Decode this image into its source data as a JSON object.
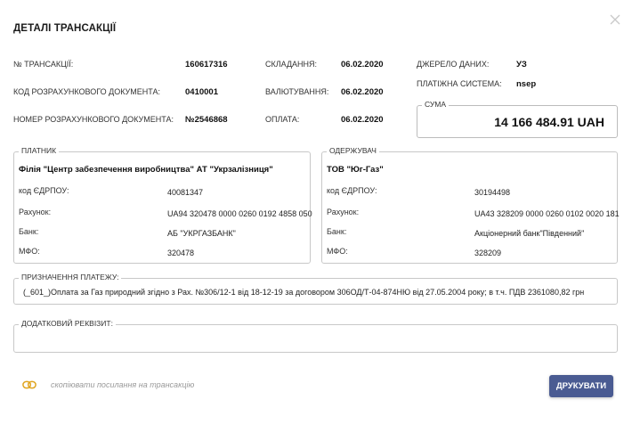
{
  "title": "ДЕТАЛІ ТРАНСАКЦІЇ",
  "transaction": {
    "number_label": "№ ТРАНСАКЦІЇ:",
    "number_value": "160617316",
    "doc_code_label": "КОД РОЗРАХУНКОВОГО ДОКУМЕНТА:",
    "doc_code_value": "0410001",
    "doc_number_label": "НОМЕР РОЗРАХУНКОВОГО ДОКУМЕНТА:",
    "doc_number_value": "№2546868",
    "compiled_label": "СКЛАДАННЯ:",
    "compiled_value": "06.02.2020",
    "valued_label": "ВАЛЮТУВАННЯ:",
    "valued_value": "06.02.2020",
    "paid_label": "ОПЛАТА:",
    "paid_value": "06.02.2020",
    "source_label": "ДЖЕРЕЛО ДАНИХ:",
    "source_value": "УЗ",
    "system_label": "ПЛАТІЖНА СИСТЕМА:",
    "system_value": "nsep",
    "sum_label": "СУМА",
    "sum_value": "14 166 484.91 UAH"
  },
  "payer": {
    "legend": "ПЛАТНИК",
    "name": "Філія \"Центр забезпечення виробництва\" АТ \"Укрзалізниця\"",
    "edrpou_label": "код ЄДРПОУ:",
    "edrpou_value": "40081347",
    "account_label": "Рахунок:",
    "account_value": "UA94 320478 0000 0260 0192 4858 050",
    "bank_label": "Банк:",
    "bank_value": "АБ \"УКРГАЗБАНК\"",
    "mfo_label": "МФО:",
    "mfo_value": "320478"
  },
  "payee": {
    "legend": "ОДЕРЖУВАЧ",
    "name": "ТОВ \"Юг-Газ\"",
    "edrpou_label": "код ЄДРПОУ:",
    "edrpou_value": "30194498",
    "account_label": "Рахунок:",
    "account_value": "UA43 328209 0000 0260 0102 0020 181",
    "bank_label": "Банк:",
    "bank_value": "Акціонерний банк\"Південний\"",
    "mfo_label": "МФО:",
    "mfo_value": "328209"
  },
  "purpose": {
    "legend": "ПРИЗНАЧЕННЯ ПЛАТЕЖУ:",
    "text": "(_601_)Оплата за Газ природний згідно з Рах. №306/12-1 від 18-12-19 за договором 306ОД/Т-04-874НЮ від 27.05.2004 року; в т.ч. ПДВ 2361080,82 грн"
  },
  "extra": {
    "legend": "ДОДАТКОВИЙ РЕКВІЗИТ:"
  },
  "footer": {
    "copy_link_text": "скопіювати посилання на трансакцію",
    "print_label": "ДРУКУВАТИ"
  },
  "colors": {
    "accent": "#4a5b92",
    "link_icon": "#e0a520",
    "border": "#c8c8c8"
  },
  "icons": {
    "close": "close-icon",
    "link": "link-icon"
  }
}
